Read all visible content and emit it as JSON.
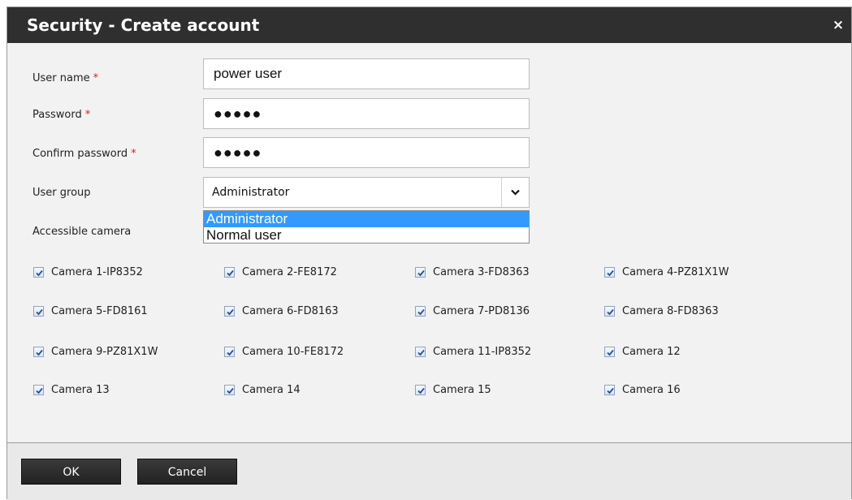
{
  "dialog": {
    "title": "Security - Create account",
    "close_label": "×"
  },
  "form": {
    "username_label": "User name",
    "username_value": "power user",
    "password_label": "Password",
    "password_value": "●●●●●",
    "confirm_label": "Confirm password",
    "confirm_value": "●●●●●",
    "required_marker": "*",
    "group_label": "User group",
    "group_value": "Administrator",
    "group_options": [
      "Administrator",
      "Normal user"
    ],
    "accessible_label": "Accessible camera"
  },
  "cameras": [
    {
      "label": "Camera 1-IP8352",
      "checked": true
    },
    {
      "label": "Camera 2-FE8172",
      "checked": true
    },
    {
      "label": "Camera 3-FD8363",
      "checked": true
    },
    {
      "label": "Camera 4-PZ81X1W",
      "checked": true
    },
    {
      "label": "Camera 5-FD8161",
      "checked": true
    },
    {
      "label": "Camera 6-FD8163",
      "checked": true
    },
    {
      "label": "Camera 7-PD8136",
      "checked": true
    },
    {
      "label": "Camera 8-FD8363",
      "checked": true
    },
    {
      "label": "Camera 9-PZ81X1W",
      "checked": true
    },
    {
      "label": "Camera 10-FE8172",
      "checked": true
    },
    {
      "label": "Camera 11-IP8352",
      "checked": true
    },
    {
      "label": "Camera 12",
      "checked": true
    },
    {
      "label": "Camera 13",
      "checked": true
    },
    {
      "label": "Camera 14",
      "checked": true
    },
    {
      "label": "Camera 15",
      "checked": true
    },
    {
      "label": "Camera 16",
      "checked": true
    }
  ],
  "footer": {
    "ok_label": "OK",
    "cancel_label": "Cancel"
  }
}
